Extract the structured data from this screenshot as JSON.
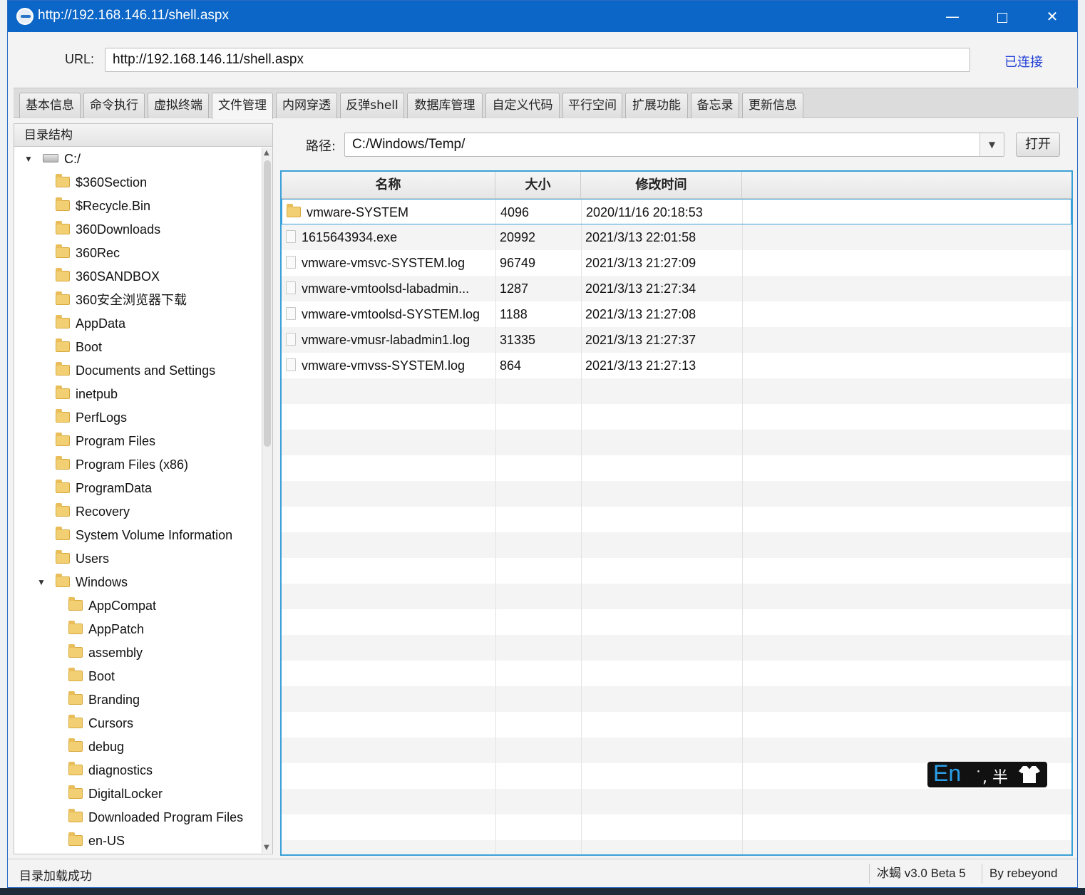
{
  "window": {
    "title": "http://192.168.146.11/shell.aspx",
    "min_glyph": "—",
    "close_glyph": "✕"
  },
  "url": {
    "label": "URL:",
    "value": "http://192.168.146.11/shell.aspx",
    "status": "已连接"
  },
  "tabs": [
    {
      "label": "基本信息"
    },
    {
      "label": "命令执行"
    },
    {
      "label": "虚拟终端"
    },
    {
      "label": "文件管理",
      "active": true
    },
    {
      "label": "内网穿透"
    },
    {
      "label": "反弹shell"
    },
    {
      "label": "数据库管理"
    },
    {
      "label": "自定义代码"
    },
    {
      "label": "平行空间"
    },
    {
      "label": "扩展功能"
    },
    {
      "label": "备忘录"
    },
    {
      "label": "更新信息"
    }
  ],
  "tree": {
    "header": "目录结构",
    "expanded_glyph": "▼",
    "items": [
      {
        "label": "C:/",
        "depth": 0,
        "type": "drive",
        "expanded": true
      },
      {
        "label": "$360Section",
        "depth": 1,
        "type": "folder"
      },
      {
        "label": "$Recycle.Bin",
        "depth": 1,
        "type": "folder"
      },
      {
        "label": "360Downloads",
        "depth": 1,
        "type": "folder"
      },
      {
        "label": "360Rec",
        "depth": 1,
        "type": "folder"
      },
      {
        "label": "360SANDBOX",
        "depth": 1,
        "type": "folder"
      },
      {
        "label": "360安全浏览器下载",
        "depth": 1,
        "type": "folder"
      },
      {
        "label": "AppData",
        "depth": 1,
        "type": "folder"
      },
      {
        "label": "Boot",
        "depth": 1,
        "type": "folder"
      },
      {
        "label": "Documents and Settings",
        "depth": 1,
        "type": "folder"
      },
      {
        "label": "inetpub",
        "depth": 1,
        "type": "folder"
      },
      {
        "label": "PerfLogs",
        "depth": 1,
        "type": "folder"
      },
      {
        "label": "Program Files",
        "depth": 1,
        "type": "folder"
      },
      {
        "label": "Program Files (x86)",
        "depth": 1,
        "type": "folder"
      },
      {
        "label": "ProgramData",
        "depth": 1,
        "type": "folder"
      },
      {
        "label": "Recovery",
        "depth": 1,
        "type": "folder"
      },
      {
        "label": "System Volume Information",
        "depth": 1,
        "type": "folder"
      },
      {
        "label": "Users",
        "depth": 1,
        "type": "folder"
      },
      {
        "label": "Windows",
        "depth": 1,
        "type": "folder",
        "expanded": true
      },
      {
        "label": "AppCompat",
        "depth": 2,
        "type": "folder"
      },
      {
        "label": "AppPatch",
        "depth": 2,
        "type": "folder"
      },
      {
        "label": "assembly",
        "depth": 2,
        "type": "folder"
      },
      {
        "label": "Boot",
        "depth": 2,
        "type": "folder"
      },
      {
        "label": "Branding",
        "depth": 2,
        "type": "folder"
      },
      {
        "label": "Cursors",
        "depth": 2,
        "type": "folder"
      },
      {
        "label": "debug",
        "depth": 2,
        "type": "folder"
      },
      {
        "label": "diagnostics",
        "depth": 2,
        "type": "folder"
      },
      {
        "label": "DigitalLocker",
        "depth": 2,
        "type": "folder"
      },
      {
        "label": "Downloaded Program Files",
        "depth": 2,
        "type": "folder"
      },
      {
        "label": "en-US",
        "depth": 2,
        "type": "folder"
      }
    ]
  },
  "path": {
    "label": "路径:",
    "value": "C:/Windows/Temp/",
    "dropdown_glyph": "▼",
    "open_button": "打开"
  },
  "files": {
    "columns": [
      "名称",
      "大小",
      "修改时间"
    ],
    "rows": [
      {
        "name": "vmware-SYSTEM",
        "size": "4096",
        "mtime": "2020/11/16 20:18:53",
        "type": "folder",
        "selected": true
      },
      {
        "name": "1615643934.exe",
        "size": "20992",
        "mtime": "2021/3/13 22:01:58",
        "type": "file"
      },
      {
        "name": "vmware-vmsvc-SYSTEM.log",
        "size": "96749",
        "mtime": "2021/3/13 21:27:09",
        "type": "file"
      },
      {
        "name": "vmware-vmtoolsd-labadmin...",
        "size": "1287",
        "mtime": "2021/3/13 21:27:34",
        "type": "file"
      },
      {
        "name": "vmware-vmtoolsd-SYSTEM.log",
        "size": "1188",
        "mtime": "2021/3/13 21:27:08",
        "type": "file"
      },
      {
        "name": "vmware-vmusr-labadmin1.log",
        "size": "31335",
        "mtime": "2021/3/13 21:27:37",
        "type": "file"
      },
      {
        "name": "vmware-vmvss-SYSTEM.log",
        "size": "864",
        "mtime": "2021/3/13 21:27:13",
        "type": "file"
      }
    ]
  },
  "ime": {
    "mode": "En",
    "rest": "˙, 半"
  },
  "status": {
    "message": "目录加载成功",
    "version": "冰蝎 v3.0 Beta 5",
    "author": "By rebeyond"
  },
  "colors": {
    "titlebar": "#0b66c7",
    "accent": "#3aa1d8",
    "status_link": "#1f3fd6"
  }
}
